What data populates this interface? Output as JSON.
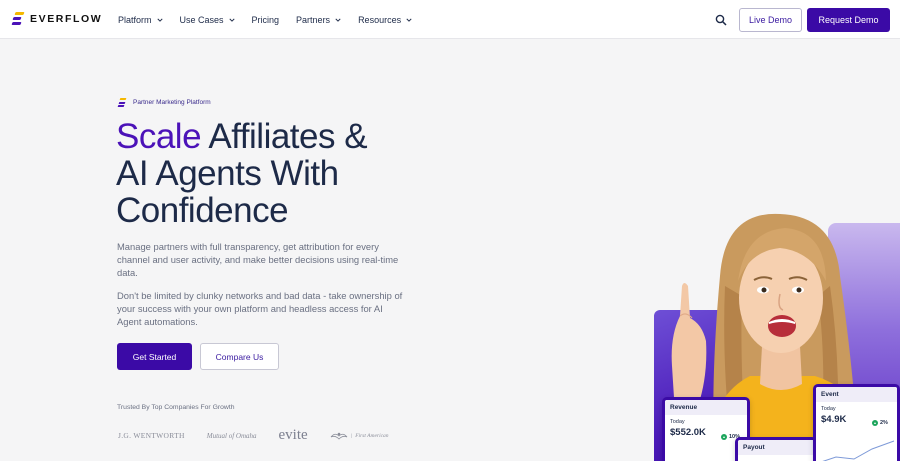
{
  "brand": {
    "name": "EVERFLOW",
    "colors": {
      "primary": "#3b0aa6",
      "accent": "#4b12b8",
      "text": "#1d2a48",
      "logo_yellow": "#f5b800",
      "logo_purple": "#4b12b8"
    }
  },
  "nav": {
    "items": [
      {
        "label": "Platform",
        "has_dropdown": true
      },
      {
        "label": "Use Cases",
        "has_dropdown": true
      },
      {
        "label": "Pricing",
        "has_dropdown": false
      },
      {
        "label": "Partners",
        "has_dropdown": true
      },
      {
        "label": "Resources",
        "has_dropdown": true
      }
    ],
    "search_icon": "search-icon",
    "live_demo_label": "Live Demo",
    "request_demo_label": "Request Demo"
  },
  "hero": {
    "eyebrow": "Partner Marketing Platform",
    "headline_accent": "Scale",
    "headline_line1_rest": " Affiliates &",
    "headline_line2": "AI Agents With",
    "headline_line3": "Confidence",
    "paragraph1": "Manage partners with full transparency, get attribution for every channel and user activity, and make better decisions using real-time data.",
    "paragraph2": "Don't be limited by clunky networks and bad data - take ownership of your success with your own platform and headless access for AI Agent automations.",
    "primary_cta": "Get Started",
    "secondary_cta": "Compare Us",
    "trusted_label": "Trusted By Top Companies For Growth",
    "logos": [
      "J.G. WENTWORTH",
      "Mutual of Omaha",
      "evite",
      "First American"
    ]
  },
  "cards": {
    "revenue": {
      "title": "Revenue",
      "period": "Today",
      "value": "$552.0K",
      "change": "10%"
    },
    "payout": {
      "title": "Payout"
    },
    "event": {
      "title": "Event",
      "period": "Today",
      "value": "$4.9K",
      "change": "2%"
    }
  }
}
